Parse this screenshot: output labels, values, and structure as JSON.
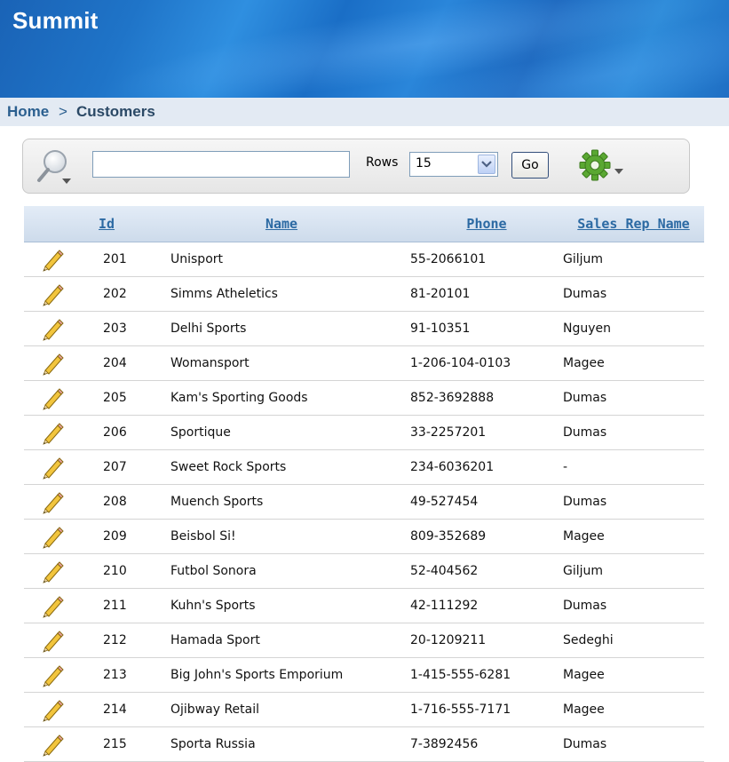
{
  "app": {
    "title": "Summit"
  },
  "breadcrumb": {
    "home": "Home",
    "separator": ">",
    "current": "Customers"
  },
  "search": {
    "value": "",
    "rows_label": "Rows",
    "rows_value": "15",
    "go_label": "Go"
  },
  "table": {
    "columns": [
      "Id",
      "Name",
      "Phone",
      "Sales Rep Name"
    ],
    "rows": [
      {
        "id": "201",
        "name": "Unisport",
        "phone": "55-2066101",
        "rep": "Giljum"
      },
      {
        "id": "202",
        "name": "Simms Atheletics",
        "phone": "81-20101",
        "rep": "Dumas"
      },
      {
        "id": "203",
        "name": "Delhi Sports",
        "phone": "91-10351",
        "rep": "Nguyen"
      },
      {
        "id": "204",
        "name": "Womansport",
        "phone": "1-206-104-0103",
        "rep": "Magee"
      },
      {
        "id": "205",
        "name": "Kam's Sporting Goods",
        "phone": "852-3692888",
        "rep": "Dumas"
      },
      {
        "id": "206",
        "name": "Sportique",
        "phone": "33-2257201",
        "rep": "Dumas"
      },
      {
        "id": "207",
        "name": "Sweet Rock Sports",
        "phone": "234-6036201",
        "rep": "-"
      },
      {
        "id": "208",
        "name": "Muench Sports",
        "phone": "49-527454",
        "rep": "Dumas"
      },
      {
        "id": "209",
        "name": "Beisbol Si!",
        "phone": "809-352689",
        "rep": "Magee"
      },
      {
        "id": "210",
        "name": "Futbol Sonora",
        "phone": "52-404562",
        "rep": "Giljum"
      },
      {
        "id": "211",
        "name": "Kuhn's Sports",
        "phone": "42-111292",
        "rep": "Dumas"
      },
      {
        "id": "212",
        "name": "Hamada Sport",
        "phone": "20-1209211",
        "rep": "Sedeghi"
      },
      {
        "id": "213",
        "name": "Big John's Sports Emporium",
        "phone": "1-415-555-6281",
        "rep": "Magee"
      },
      {
        "id": "214",
        "name": "Ojibway Retail",
        "phone": "1-716-555-7171",
        "rep": "Magee"
      },
      {
        "id": "215",
        "name": "Sporta Russia",
        "phone": "7-3892456",
        "rep": "Dumas"
      }
    ]
  },
  "icons": {
    "search": "search-icon",
    "gear": "gear-icon",
    "edit": "pencil-icon",
    "dropdown": "chevron-down-icon"
  },
  "colors": {
    "header_blue": "#1f74c8",
    "link_blue": "#2c6aa3",
    "breadcrumb_bg": "#e3eaf3",
    "gear_green": "#4e9a2c"
  }
}
